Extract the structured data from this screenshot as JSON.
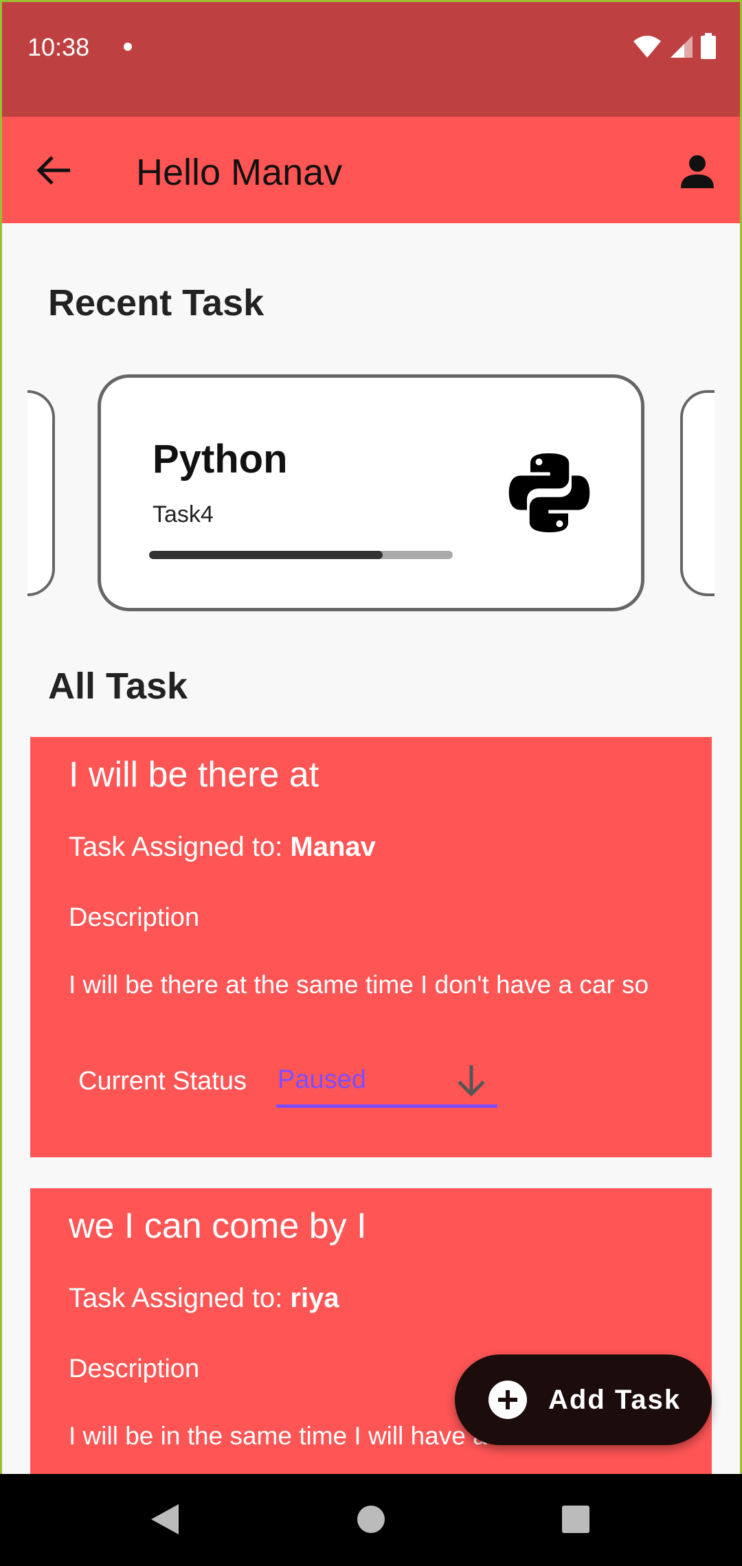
{
  "status_bar": {
    "time": "10:38"
  },
  "app_bar": {
    "title": "Hello Manav"
  },
  "recent": {
    "heading": "Recent Task",
    "card": {
      "title": "Python",
      "subtitle": "Task4",
      "progress": 0.77,
      "icon": "python-logo-icon"
    }
  },
  "all_tasks": {
    "heading": "All Task",
    "assigned_prefix": "Task Assigned to: ",
    "description_label": "Description",
    "status_label": "Current Status",
    "items": [
      {
        "title": "I will be there at",
        "assignee": "Manav",
        "description": "I will be there at the same time I don't have a car so",
        "status": "Paused"
      },
      {
        "title": "we I can come by I",
        "assignee": "riya",
        "description": "I will be in the same time I will have a car so we"
      }
    ]
  },
  "fab": {
    "label": "Add Task",
    "icon": "plus-circle-icon"
  },
  "colors": {
    "status_bar": "#bf4040",
    "accent": "#ff5555",
    "select_accent": "#7c4dff",
    "fab": "#1c0c0c"
  }
}
